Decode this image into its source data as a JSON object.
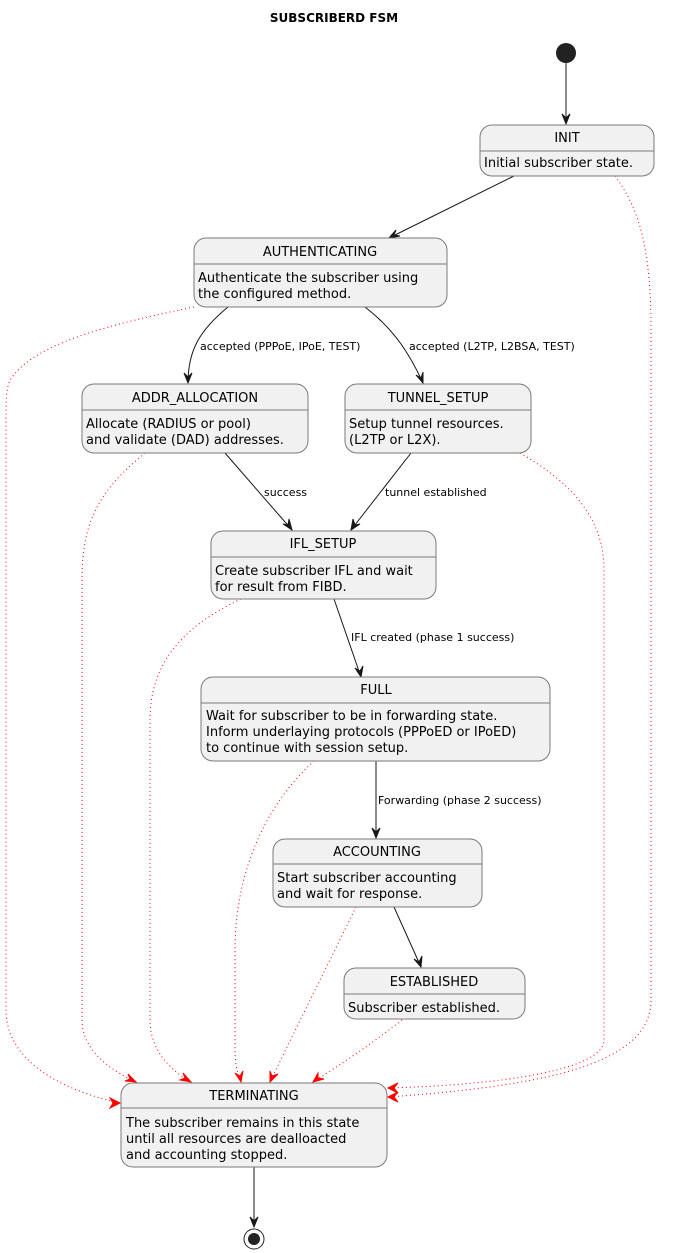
{
  "title": "SUBSCRIBERD FSM",
  "colors": {
    "state_fill": "#F1F1F1",
    "state_border": "#7a7a7a",
    "transition": "#181818",
    "error_transition": "#FF0000"
  },
  "states": {
    "init": {
      "name": "INIT",
      "desc": [
        "Initial subscriber state."
      ]
    },
    "authenticating": {
      "name": "AUTHENTICATING",
      "desc": [
        "Authenticate the subscriber using",
        "the configured method."
      ]
    },
    "addr_allocation": {
      "name": "ADDR_ALLOCATION",
      "desc": [
        "Allocate (RADIUS or pool)",
        "and validate (DAD) addresses."
      ]
    },
    "tunnel_setup": {
      "name": "TUNNEL_SETUP",
      "desc": [
        "Setup tunnel resources.",
        "(L2TP or L2X)."
      ]
    },
    "ifl_setup": {
      "name": "IFL_SETUP",
      "desc": [
        "Create subscriber IFL and wait",
        "for result from FIBD."
      ]
    },
    "full": {
      "name": "FULL",
      "desc": [
        "Wait for subscriber to be in forwarding state.",
        "Inform underlaying protocols (PPPoED or IPoED)",
        "to continue with session setup."
      ]
    },
    "accounting": {
      "name": "ACCOUNTING",
      "desc": [
        "Start subscriber accounting",
        "and wait for response."
      ]
    },
    "established": {
      "name": "ESTABLISHED",
      "desc": [
        "Subscriber established."
      ]
    },
    "terminating": {
      "name": "TERMINATING",
      "desc": [
        "The subscriber remains in this state",
        "until all resources are dealloacted",
        "and accounting stopped."
      ]
    }
  },
  "transitions": {
    "start_to_init": {
      "from": "start",
      "to": "INIT",
      "label": ""
    },
    "init_to_auth": {
      "from": "INIT",
      "to": "AUTHENTICATING",
      "label": ""
    },
    "auth_to_addr": {
      "from": "AUTHENTICATING",
      "to": "ADDR_ALLOCATION",
      "label": "accepted (PPPoE, IPoE, TEST)"
    },
    "auth_to_tunnel": {
      "from": "AUTHENTICATING",
      "to": "TUNNEL_SETUP",
      "label": "accepted (L2TP, L2BSA, TEST)"
    },
    "addr_to_ifl": {
      "from": "ADDR_ALLOCATION",
      "to": "IFL_SETUP",
      "label": "success"
    },
    "tunnel_to_ifl": {
      "from": "TUNNEL_SETUP",
      "to": "IFL_SETUP",
      "label": "tunnel established"
    },
    "ifl_to_full": {
      "from": "IFL_SETUP",
      "to": "FULL",
      "label": "IFL created (phase 1 success)"
    },
    "full_to_acct": {
      "from": "FULL",
      "to": "ACCOUNTING",
      "label": "Forwarding (phase 2 success)"
    },
    "acct_to_est": {
      "from": "ACCOUNTING",
      "to": "ESTABLISHED",
      "label": ""
    },
    "term_to_end": {
      "from": "TERMINATING",
      "to": "end",
      "label": ""
    }
  },
  "error_transitions": [
    "INIT",
    "AUTHENTICATING",
    "ADDR_ALLOCATION",
    "TUNNEL_SETUP",
    "IFL_SETUP",
    "FULL",
    "ACCOUNTING",
    "ESTABLISHED"
  ]
}
